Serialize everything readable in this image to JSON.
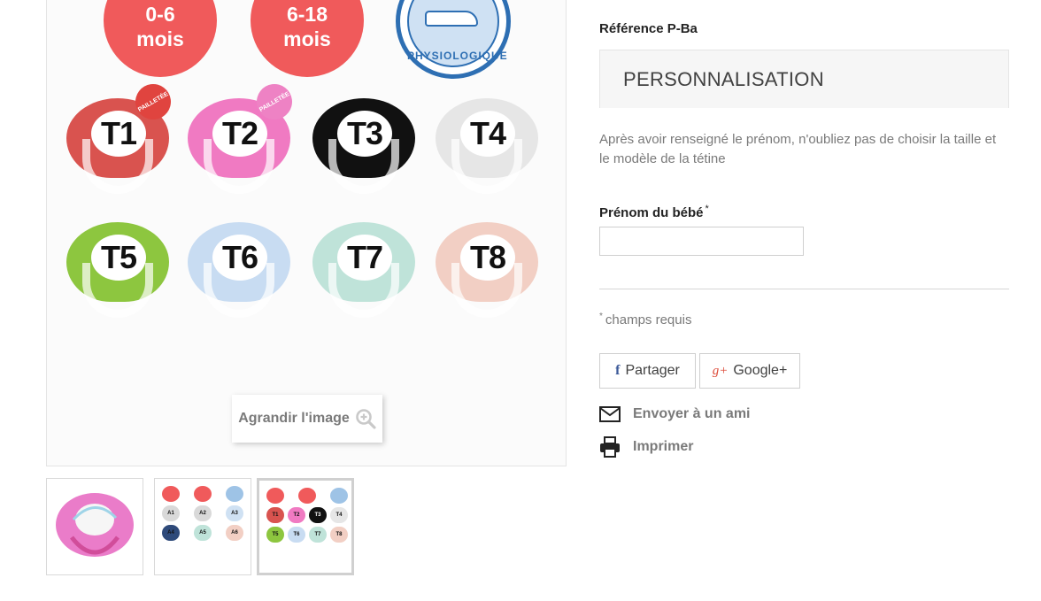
{
  "main_image": {
    "badges": [
      "0-6\nmois",
      "6-18\nmois"
    ],
    "badge_lines": [
      [
        "0-6",
        "mois"
      ],
      [
        "6-18",
        "mois"
      ]
    ],
    "physio_label": "PHYSIOLOGIQUE",
    "pacifiers": [
      {
        "label": "T1",
        "color": "#d9534f",
        "tag": "PAILLETÉE",
        "tag_color": "#e0443f"
      },
      {
        "label": "T2",
        "color": "#f07ac2",
        "tag": "PAILLETÉE",
        "tag_color": "#ee82c4"
      },
      {
        "label": "T3",
        "color": "#111111",
        "tag": ""
      },
      {
        "label": "T4",
        "color": "#e6e6e6",
        "tag": ""
      },
      {
        "label": "T5",
        "color": "#8dc63f",
        "tag": ""
      },
      {
        "label": "T6",
        "color": "#c8dcf2",
        "tag": ""
      },
      {
        "label": "T7",
        "color": "#bfe3d9",
        "tag": ""
      },
      {
        "label": "T8",
        "color": "#f2cfc4",
        "tag": ""
      }
    ],
    "zoom_label": "Agrandir l'image"
  },
  "thumbnails": [
    {
      "kind": "photo",
      "selected": false
    },
    {
      "kind": "grid",
      "selected": false,
      "labels": [
        "A1",
        "A2",
        "A3",
        "A4",
        "A5",
        "A6"
      ],
      "top": [
        "0-6\nmois",
        "6-18\nmois"
      ]
    },
    {
      "kind": "grid",
      "selected": true,
      "labels": [
        "T1",
        "T2",
        "T3",
        "T4",
        "T5",
        "T6",
        "T7",
        "T8"
      ]
    }
  ],
  "product": {
    "reference_label": "Référence",
    "reference_value": "P-Ba"
  },
  "personalization": {
    "tab_title": "PERSONNALISATION",
    "description": "Après avoir renseigné le prénom, n'oubliez pas de choisir la taille et le modèle de la tétine",
    "field_label": "Prénom du bébé",
    "field_required_mark": "*",
    "field_value": "",
    "required_note_mark": "*",
    "required_note": "champs requis"
  },
  "social": {
    "facebook_label": "Partager",
    "google_label": "Google+",
    "facebook_icon": "f",
    "google_icon": "g+"
  },
  "actions": {
    "email_label": "Envoyer à un ami",
    "print_label": "Imprimer"
  },
  "colors": {
    "badge_red": "#f05a5b",
    "physio_blue": "#2e6fb3",
    "facebook_blue": "#3b5998",
    "google_red": "#dd4b39"
  }
}
